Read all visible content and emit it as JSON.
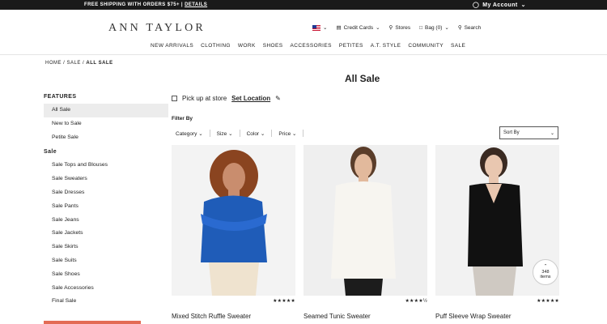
{
  "topbar": {
    "promo_text": "FREE SHIPPING WITH ORDERS $75+ | ",
    "promo_link": "DETAILS",
    "account": "My Account"
  },
  "header": {
    "logo": "ANN TAYLOR",
    "credit_cards": "Credit Cards",
    "stores": "Stores",
    "bag": "Bag (0)",
    "search": "Search"
  },
  "nav": {
    "items": [
      "NEW ARRIVALS",
      "CLOTHING",
      "WORK",
      "SHOES",
      "ACCESSORIES",
      "PETITES",
      "A.T. STYLE",
      "COMMUNITY",
      "SALE"
    ]
  },
  "breadcrumb": {
    "home": "HOME",
    "sale": "SALE",
    "current": "ALL SALE",
    "sep": "/"
  },
  "page_title": "All Sale",
  "sidebar": {
    "features_heading": "FEATURES",
    "features": [
      "All Sale",
      "New to Sale",
      "Petite Sale"
    ],
    "sale_heading": "Sale",
    "sale_items": [
      "Sale Tops and Blouses",
      "Sale Sweaters",
      "Sale Dresses",
      "Sale Pants",
      "Sale Jeans",
      "Sale Jackets",
      "Sale Skirts",
      "Sale Suits",
      "Sale Shoes",
      "Sale Accessories",
      "Final Sale"
    ]
  },
  "pickup": {
    "label": "Pick up at store",
    "link": "Set Location"
  },
  "filters": {
    "heading": "Filter By",
    "items": [
      "Category",
      "Size",
      "Color",
      "Price"
    ],
    "sort_label": "Sort By"
  },
  "products": [
    {
      "name": "Mixed Stitch Ruffle Sweater",
      "stars": "★★★★★",
      "top_color": "#1f5cb8",
      "bottom_color": "#efe3cf",
      "bg": "#f3f3f3",
      "skin": "#c98d6e",
      "hair": "#8a4420"
    },
    {
      "name": "Seamed Tunic Sweater",
      "stars": "★★★★½",
      "top_color": "#f7f5f0",
      "bottom_color": "#1c1c1c",
      "bg": "#efefef",
      "skin": "#e2b99c",
      "hair": "#5a3d2a"
    },
    {
      "name": "Puff Sleeve Wrap Sweater",
      "stars": "★★★★★",
      "top_color": "#111111",
      "bottom_color": "#cfc9c2",
      "bg": "#f2f2f2",
      "skin": "#e9c7b0",
      "hair": "#3a2a22"
    }
  ],
  "badge": {
    "count": "348",
    "label": "items"
  }
}
